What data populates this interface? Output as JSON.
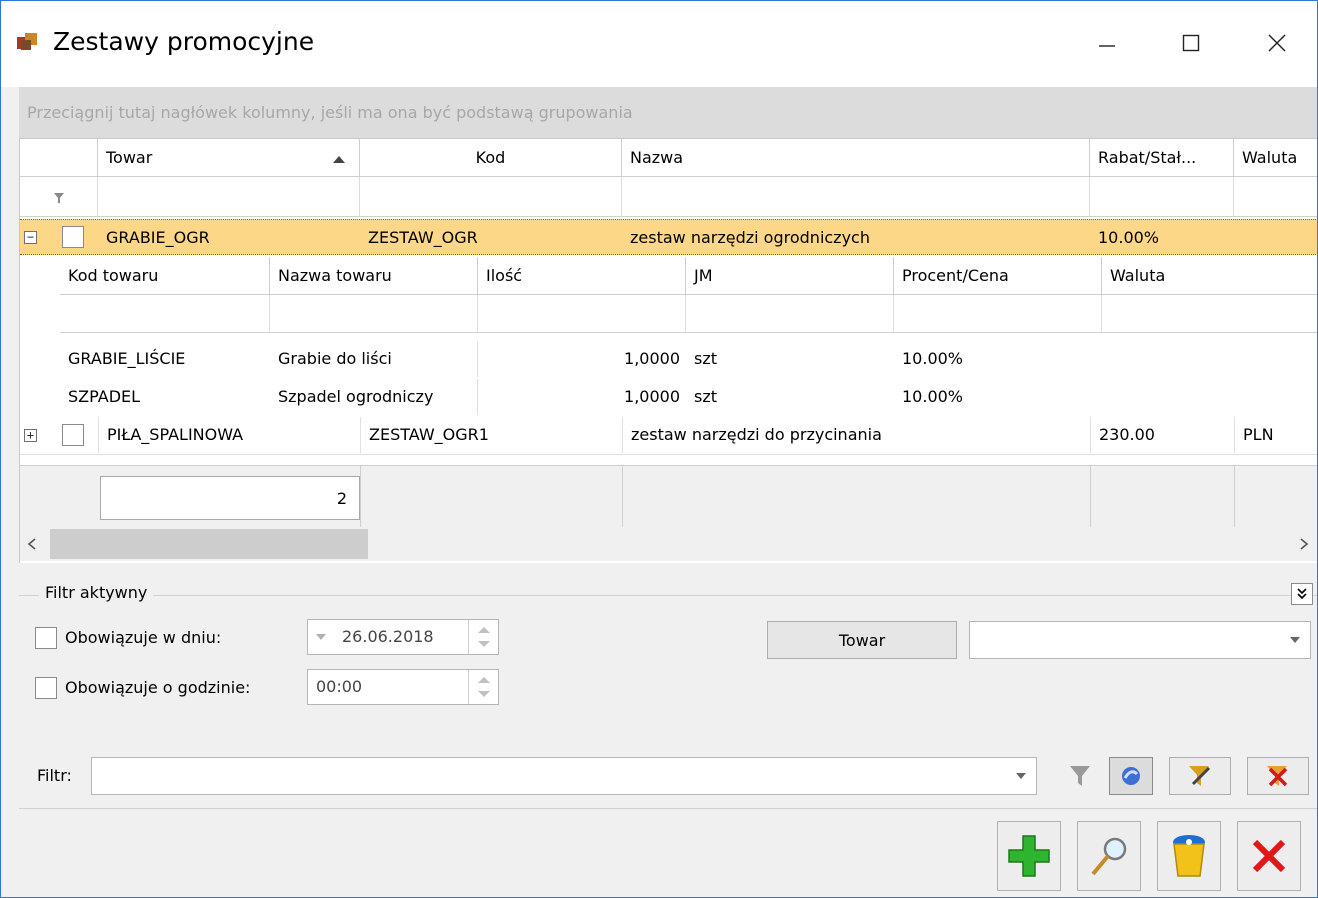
{
  "window": {
    "title": "Zestawy promocyjne"
  },
  "grid": {
    "group_hint": "Przeciągnij tutaj nagłówek kolumny, jeśli ma ona być podstawą grupowania",
    "columns": [
      "Towar",
      "Kod",
      "Nazwa",
      "Rabat/Stał...",
      "Waluta"
    ],
    "sort_column": "Towar",
    "rows": [
      {
        "towar": "GRABIE_OGR",
        "kod": "ZESTAW_OGR",
        "nazwa": "zestaw narzędzi ogrodniczych",
        "rabat": "10.00%",
        "waluta": "",
        "expanded": true
      },
      {
        "towar": "PIŁA_SPALINOWA",
        "kod": "ZESTAW_OGR1",
        "nazwa": "zestaw narzędzi do przycinania",
        "rabat": "230.00",
        "waluta": "PLN",
        "expanded": false
      }
    ],
    "detail": {
      "columns": [
        "Kod towaru",
        "Nazwa towaru",
        "Ilość",
        "JM",
        "Procent/Cena",
        "Waluta"
      ],
      "rows": [
        {
          "kod": "GRABIE_LIŚCIE",
          "nazwa": "Grabie do liści",
          "ilosc": "1,0000",
          "jm": "szt",
          "procent": "10.00%",
          "waluta": ""
        },
        {
          "kod": "SZPADEL",
          "nazwa": "Szpadel ogrodniczy",
          "ilosc": "1,0000",
          "jm": "szt",
          "procent": "10.00%",
          "waluta": ""
        }
      ]
    },
    "footer_count": "2"
  },
  "filter": {
    "legend": "Filtr aktywny",
    "on_day_label": "Obowiązuje w dniu:",
    "on_day_value": "26.06.2018",
    "on_hour_label": "Obowiązuje o godzinie:",
    "on_hour_value": "00:00",
    "towar_button": "Towar",
    "towar_value": "",
    "filter_label": "Filtr:",
    "filter_value": ""
  },
  "colors": {
    "selected_row": "#fcd788",
    "accent": "#2b79d7"
  }
}
